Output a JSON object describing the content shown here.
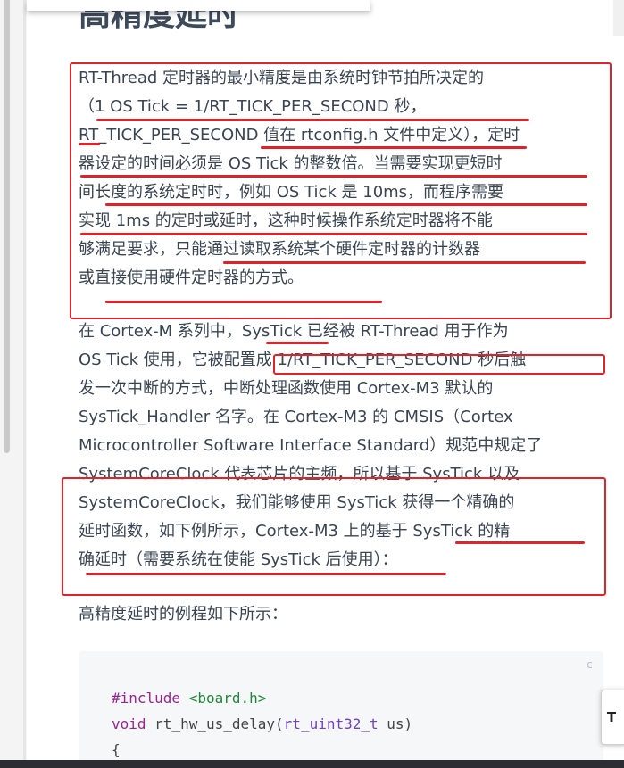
{
  "heading": "高精度延时",
  "paragraph1": [
    "RT-Thread 定时器的最小精度是由系统时钟节拍所决定的",
    "（1 OS Tick = 1/RT_TICK_PER_SECOND 秒，",
    "RT_TICK_PER_SECOND 值在 rtconfig.h 文件中定义），定时",
    "器设定的时间必须是 OS Tick 的整数倍。当需要实现更短时",
    "间长度的系统定时时，例如 OS Tick 是 10ms，而程序需要",
    "实现 1ms 的定时或延时，这种时候操作系统定时器将不能",
    "够满足要求，只能通过读取系统某个硬件定时器的计数器",
    "或直接使用硬件定时器的方式。"
  ],
  "paragraph2": [
    "在 Cortex-M 系列中，SysTick 已经被 RT-Thread 用于作为",
    "OS Tick 使用，它被配置成 1/RT_TICK_PER_SECOND 秒后触",
    "发一次中断的方式，中断处理函数使用 Cortex-M3 默认的",
    "SysTick_Handler 名字。在 Cortex-M3 的 CMSIS（Cortex",
    "Microcontroller Software Interface Standard）规范中规定了",
    "SystemCoreClock 代表芯片的主频，所以基于 SysTick 以及",
    "SystemCoreClock，我们能够使用 SysTick 获得一个精确的",
    "延时函数，如下例所示，Cortex-M3 上的基于 SysTick 的精",
    "确延时（需要系统在使能 SysTick 后使用）："
  ],
  "paragraph3": "高精度延时的例程如下所示：",
  "code": {
    "lang_label": "c",
    "line1_kw": "#include",
    "line1_hdr": "<board.h>",
    "line2_kw": "void",
    "line2_fn": "rt_hw_us_delay(",
    "line2_type": "rt_uint32_t",
    "line2_rest": "us)",
    "line3": "{"
  },
  "float_button_label": "T",
  "colors": {
    "annotation_red": "#e0222a",
    "code_bg": "#f6f7f8"
  }
}
